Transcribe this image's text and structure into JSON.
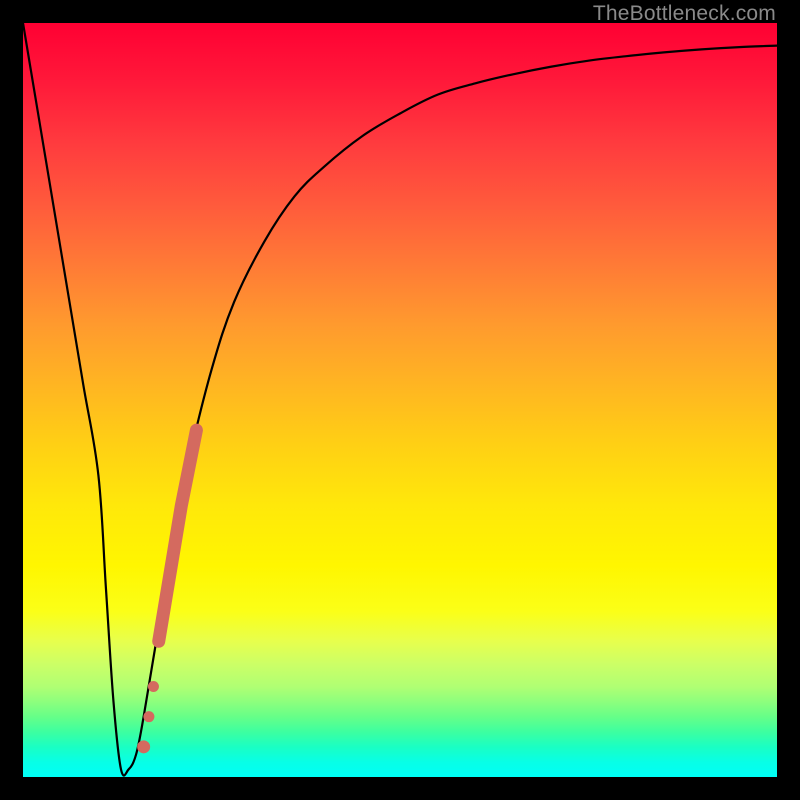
{
  "watermark": {
    "text": "TheBottleneck.com"
  },
  "chart_data": {
    "type": "line",
    "title": "",
    "xlabel": "",
    "ylabel": "",
    "xlim": [
      0,
      100
    ],
    "ylim": [
      0,
      100
    ],
    "series": [
      {
        "name": "bottleneck-curve",
        "color": "#000000",
        "x": [
          0,
          2,
          4,
          6,
          8,
          10,
          11,
          12,
          13,
          14,
          15,
          16,
          18,
          20,
          22,
          25,
          28,
          32,
          36,
          40,
          45,
          50,
          55,
          60,
          65,
          70,
          75,
          80,
          85,
          90,
          95,
          100
        ],
        "y": [
          100,
          88,
          76,
          64,
          52,
          40,
          25,
          10,
          1,
          1,
          3,
          8,
          20,
          32,
          42,
          54,
          63,
          71,
          77,
          81,
          85,
          88,
          90.5,
          92,
          93.2,
          94.2,
          95,
          95.6,
          96.1,
          96.5,
          96.8,
          97
        ]
      }
    ],
    "markers": {
      "name": "highlight-segment",
      "color": "#d46a5f",
      "points": [
        {
          "x": 16.0,
          "y": 4
        },
        {
          "x": 16.7,
          "y": 8
        },
        {
          "x": 17.3,
          "y": 12
        },
        {
          "x": 18.0,
          "y": 18
        },
        {
          "x": 19.0,
          "y": 24
        },
        {
          "x": 20.0,
          "y": 30
        },
        {
          "x": 21.0,
          "y": 36
        },
        {
          "x": 22.0,
          "y": 41
        },
        {
          "x": 23.0,
          "y": 46
        }
      ]
    },
    "gradient_stops": [
      {
        "pos": 0,
        "color": "#ff0033"
      },
      {
        "pos": 50,
        "color": "#ffcc00"
      },
      {
        "pos": 78,
        "color": "#ffff00"
      },
      {
        "pos": 100,
        "color": "#00ffee"
      }
    ]
  }
}
